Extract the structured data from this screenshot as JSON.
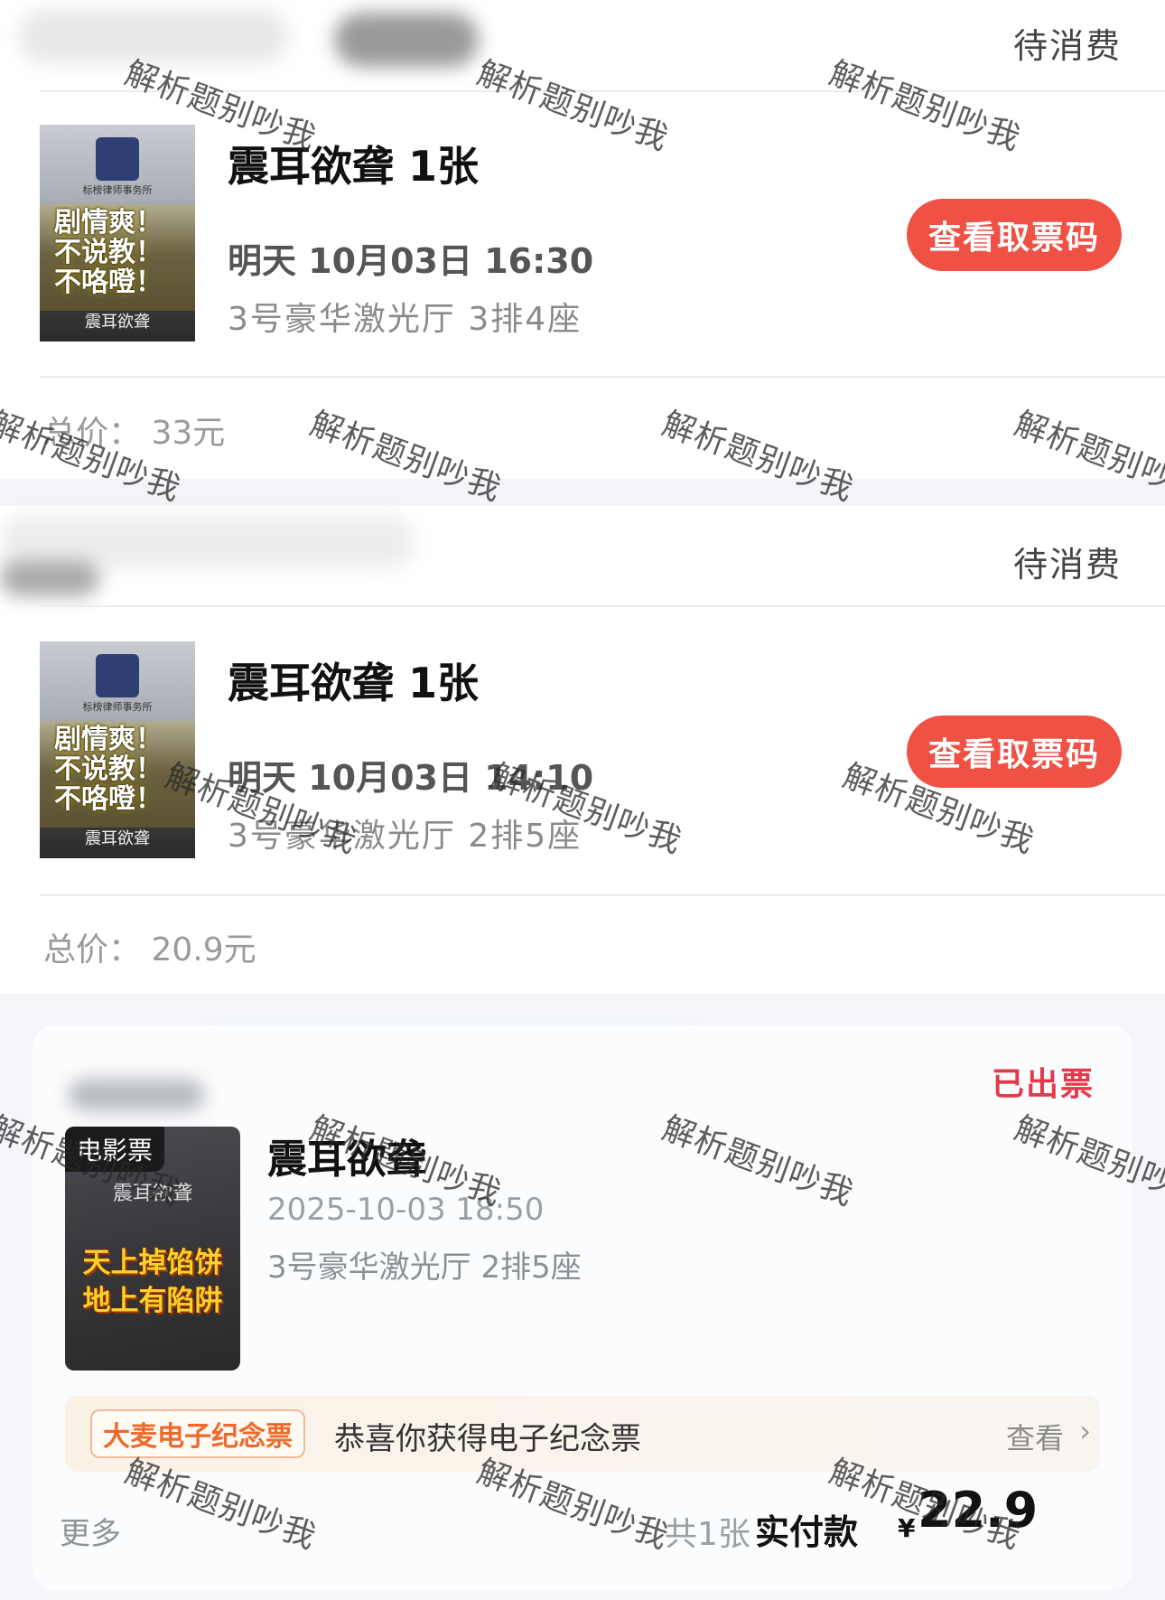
{
  "orders": [
    {
      "status": "待消费",
      "poster": {
        "firm": "标榜律师事务所",
        "slogan_lines": [
          "剧情爽！",
          "不说教！",
          "不咯噔！"
        ],
        "signature": "震耳欲聋"
      },
      "title": "震耳欲聋 1张",
      "time": "明天 10月03日 16:30",
      "seat": "3号豪华激光厅 3排4座",
      "button": "查看取票码",
      "price": "总价： 33元"
    },
    {
      "status": "待消费",
      "poster": {
        "firm": "标榜律师事务所",
        "slogan_lines": [
          "剧情爽！",
          "不说教！",
          "不咯噔！"
        ],
        "signature": "震耳欲聋"
      },
      "title": "震耳欲聋 1张",
      "time": "明天 10月03日 14:10",
      "seat": "3号豪华激光厅 2排5座",
      "button": "查看取票码",
      "price": "总价： 20.9元"
    }
  ],
  "ticket_card": {
    "status": "已出票",
    "poster_tag": "电影票",
    "poster_title": "震耳欲聋",
    "poster_slogan": [
      "天上掉馅饼",
      "地上有陷阱"
    ],
    "title": "震耳欲聋",
    "datetime": "2025-10-03 18:50",
    "seat": "3号豪华激光厅 2排5座",
    "banner": {
      "tag": "大麦电子纪念票",
      "message": "恭喜你获得电子纪念票",
      "view": "查看",
      "chevron": "›"
    },
    "more": "更多",
    "count": "共1张",
    "paid_label": "实付款",
    "currency": "¥",
    "amount": "22.9"
  },
  "watermark": "解析题别吵我",
  "colors": {
    "button": "#ef5144",
    "issued": "#e23a4a",
    "banner_tag": "#ee6a2c"
  }
}
